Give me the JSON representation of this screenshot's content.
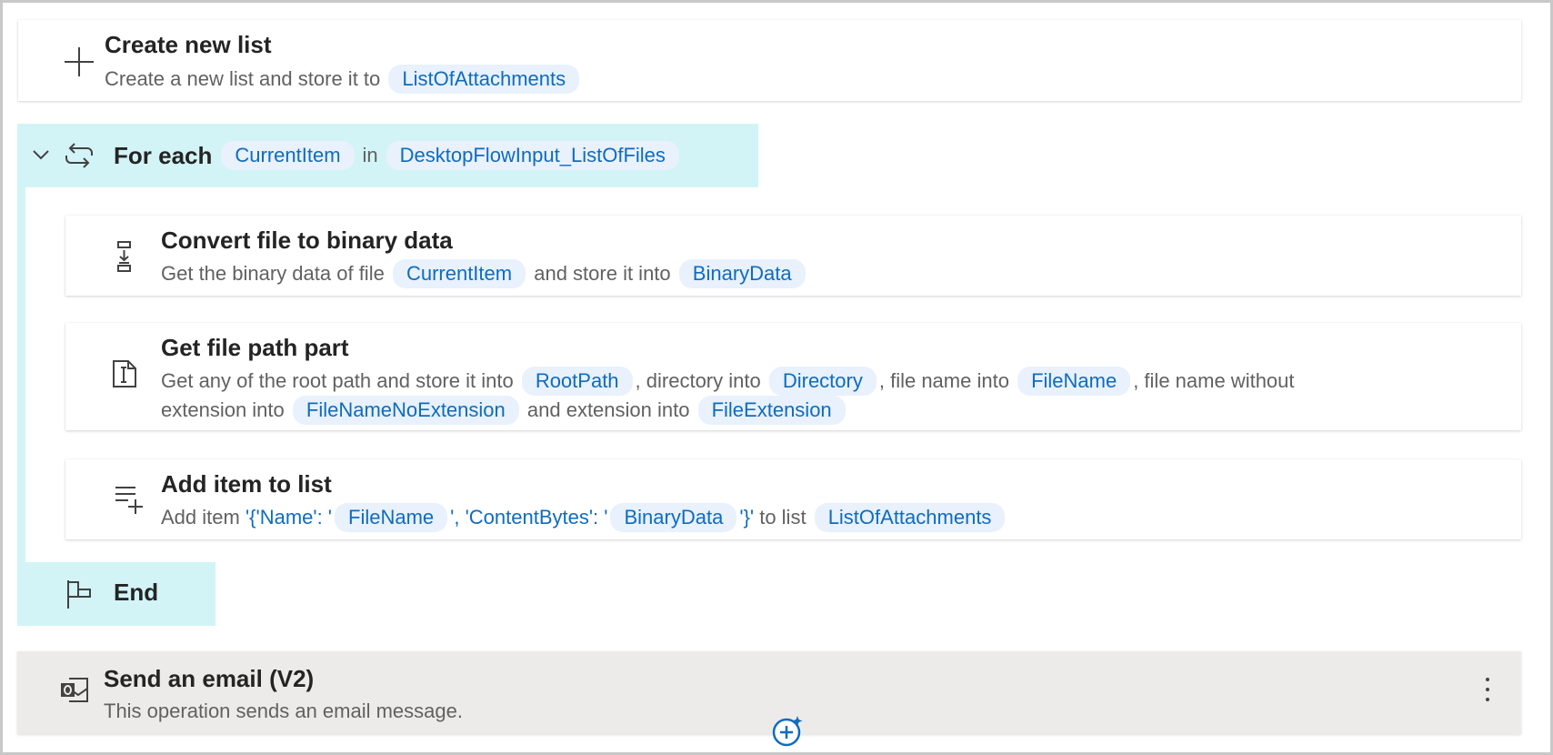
{
  "create_list": {
    "title": "Create new list",
    "desc_prefix": "Create a new list and store it to",
    "var": "ListOfAttachments",
    "icon": "plus-icon"
  },
  "for_each": {
    "title": "For each",
    "item_var": "CurrentItem",
    "in_word": "in",
    "list_var": "DesktopFlowInput_ListOfFiles",
    "icons": [
      "chevron-down-icon",
      "loop-icon"
    ]
  },
  "convert": {
    "title": "Convert file to binary data",
    "desc_1": "Get the binary data of file",
    "var_1": "CurrentItem",
    "desc_2": "and store it into",
    "var_2": "BinaryData",
    "icon": "binary-convert-icon"
  },
  "file_path": {
    "title": "Get file path part",
    "line1_a": "Get any of the root path and store it into",
    "var_root": "RootPath",
    "line1_b": ", directory into",
    "var_dir": "Directory",
    "line1_c": ", file name into",
    "var_name": "FileName",
    "line1_d": ", file name without",
    "line2_a": "extension into",
    "var_noext": "FileNameNoExtension",
    "line2_b": "and extension into",
    "var_ext": "FileExtension",
    "icon": "file-path-icon"
  },
  "add_item": {
    "title": "Add item to list",
    "desc_1": "Add item",
    "lit_1": "'{'Name': '",
    "var_1": "FileName",
    "lit_2": "', 'ContentBytes': '",
    "var_2": "BinaryData",
    "lit_3": "'}'",
    "desc_2": "to list",
    "var_3": "ListOfAttachments",
    "icon": "add-to-list-icon"
  },
  "end": {
    "title": "End",
    "icon": "flag-icon"
  },
  "email": {
    "title": "Send an email (V2)",
    "desc": "This operation sends an email message.",
    "icon": "outlook-icon",
    "more_icon": "more-vertical-icon"
  },
  "add_step_icon": "copilot-add-icon",
  "colors": {
    "token_bg": "#e8f1fc",
    "token_text": "#0f6cbd",
    "loop_bg": "#d2f4f7",
    "email_bg": "#edebe9"
  }
}
